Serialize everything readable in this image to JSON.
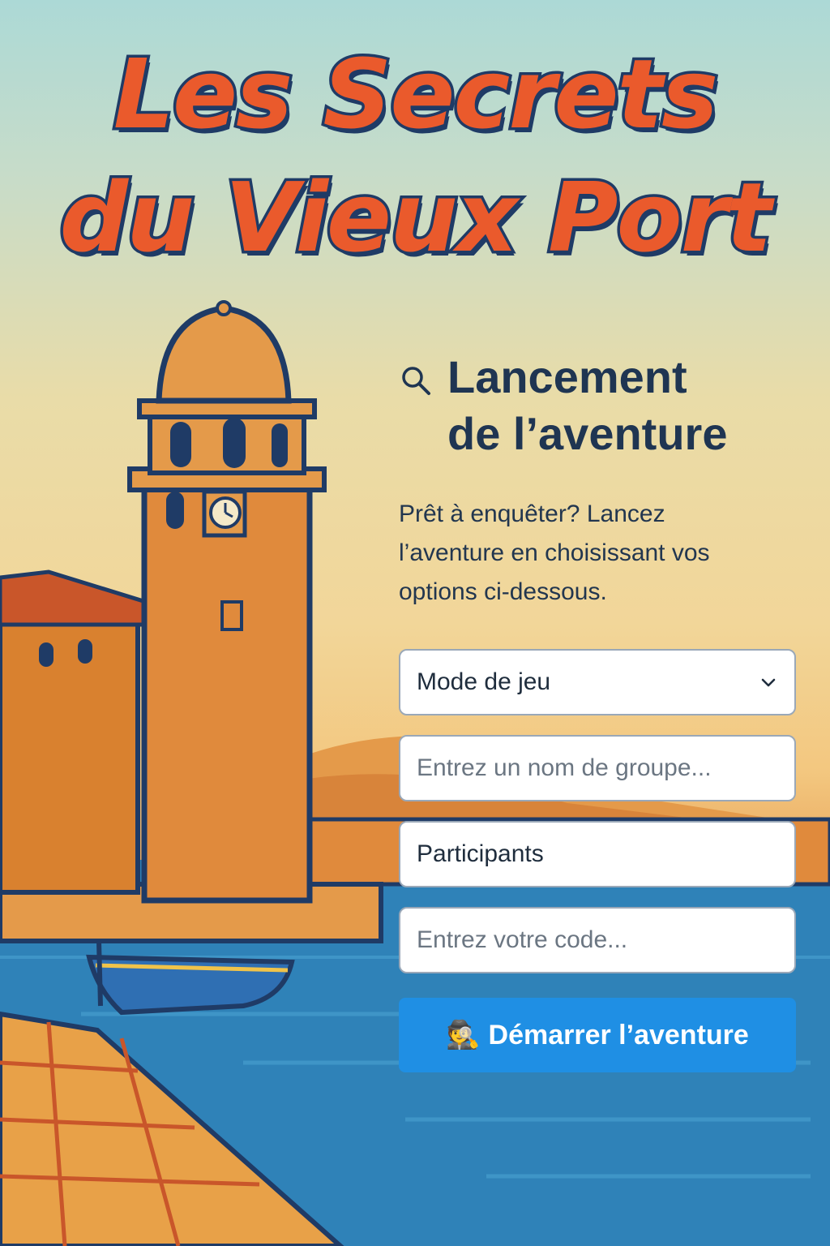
{
  "header": {
    "title_line1": "Les Secrets",
    "title_line2": "du Vieux Port"
  },
  "panel": {
    "heading_line1": "Lancement",
    "heading_line2": "de l’aventure",
    "intro": "Prêt à enquêter? Lancez l’aventure en choisissant vos options ci-dessous.",
    "mode_select": {
      "selected": "Mode de jeu"
    },
    "group_input": {
      "placeholder": "Entrez un nom de groupe...",
      "value": ""
    },
    "participants_input": {
      "value": "Participants"
    },
    "code_input": {
      "placeholder": "Entrez votre code...",
      "value": ""
    },
    "start_button": {
      "icon": "🕵",
      "label": "Démarrer l’aventure"
    }
  },
  "colors": {
    "title": "#ea5a2c",
    "outline": "#1f3b66",
    "heading": "#1f3552",
    "button": "#1f8fe4",
    "sea": "#2f82b8"
  },
  "icons": {
    "search": "search-icon",
    "chevron": "chevron-down-icon",
    "detective": "detective-icon"
  }
}
